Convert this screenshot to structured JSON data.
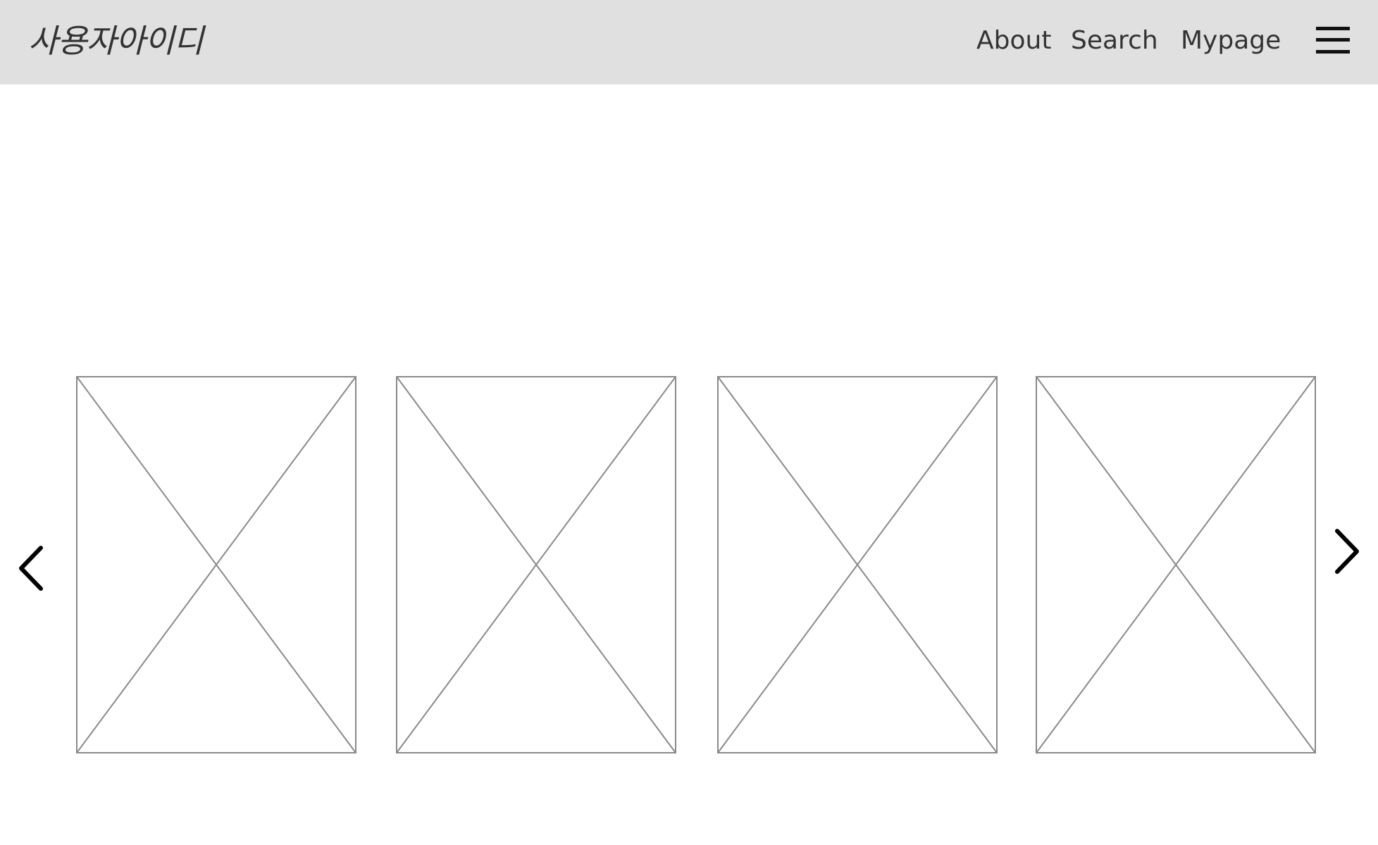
{
  "header": {
    "user_id": "사용자아이디",
    "nav": {
      "about": "About",
      "search": "Search",
      "mypage": "Mypage"
    },
    "menu_icon": "hamburger-menu-icon"
  },
  "carousel": {
    "prev_icon": "chevron-left-icon",
    "next_icon": "chevron-right-icon",
    "slides": [
      {
        "placeholder": "image-placeholder"
      },
      {
        "placeholder": "image-placeholder"
      },
      {
        "placeholder": "image-placeholder"
      },
      {
        "placeholder": "image-placeholder"
      }
    ]
  },
  "colors": {
    "header_bg": "#e0e0e0",
    "text": "#333333",
    "placeholder_stroke": "#8a8a8a"
  }
}
